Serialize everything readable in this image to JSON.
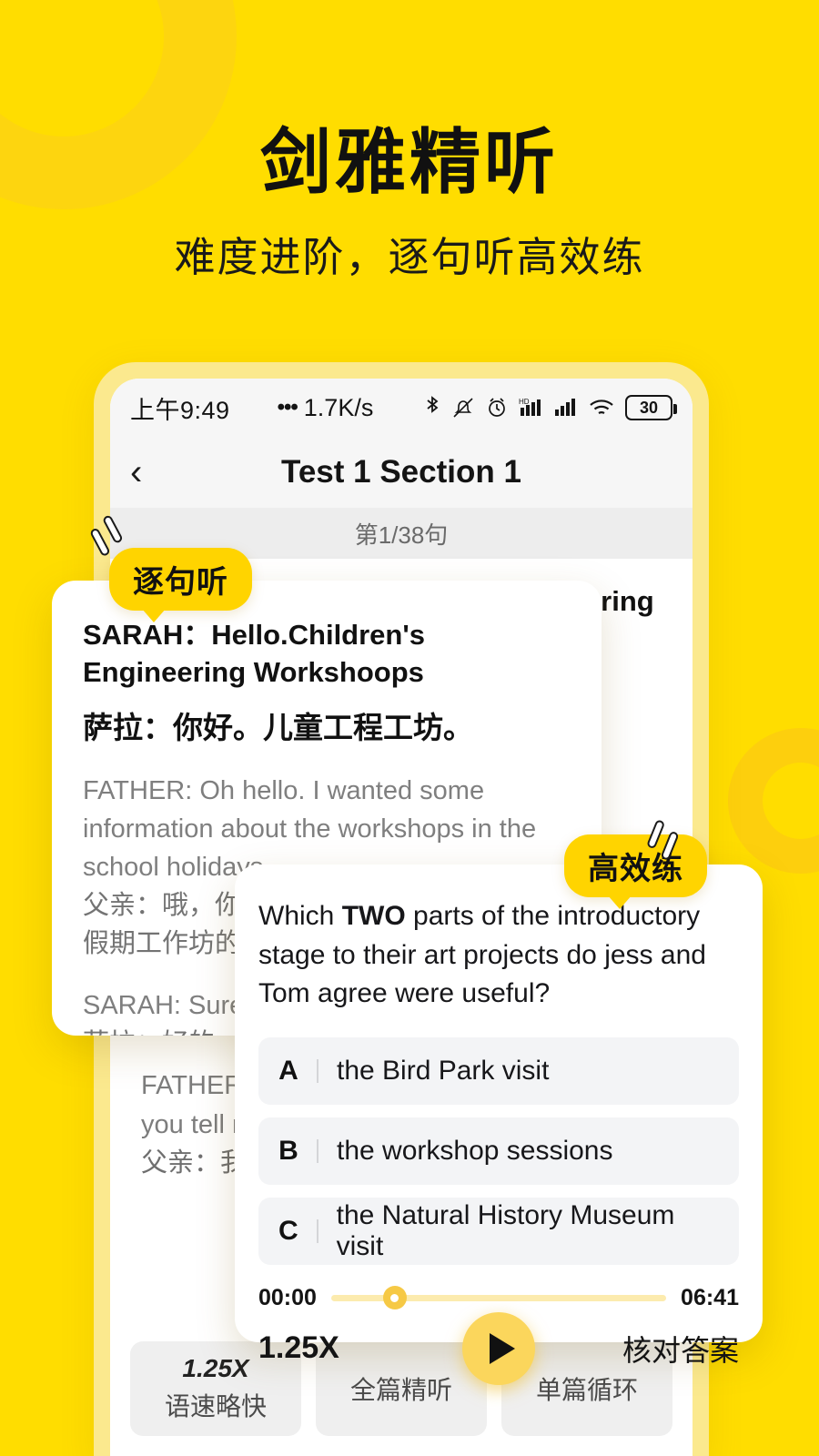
{
  "hero": {
    "title": "剑雅精听",
    "subtitle": "难度进阶，逐句听高效练"
  },
  "colors": {
    "background": "#FFDD00",
    "accent": "#FFD400",
    "phone_bezel": "#FBE98E",
    "play_button": "#FBD65C",
    "option_bg": "#F3F4F6"
  },
  "badges": {
    "listen": "逐句听",
    "practice": "高效练"
  },
  "phone": {
    "statusbar": {
      "time": "上午9:49",
      "dots": "•••",
      "net_speed": "1.7K/s",
      "battery": "30",
      "icons": [
        "bluetooth-icon",
        "bell-mute-icon",
        "alarm-icon",
        "hd-signal-icon",
        "signal-icon",
        "wifi-icon",
        "battery-icon"
      ]
    },
    "navbar": {
      "back": "‹",
      "title": "Test 1 Section 1"
    },
    "subbar": {
      "progress": "第1/38句"
    },
    "transcript": {
      "active_en": "SARAH：Hello.Children's Engineering Workshoops",
      "active_zh": "萨拉：你好。儿童工程工坊。",
      "lines": [
        {
          "en": "FATHER: Oh hello. I wanted some information about the workshops in the school holidays.",
          "zh": "父亲：哦，你好。我想了解一些关于学校假期工作坊的信息。"
        },
        {
          "en": "SARAH: Sure.",
          "zh": "萨拉：好的。"
        },
        {
          "en": "FATHER: I'm interested in the four — could you tell me about that?",
          "zh": "父亲：我的孩子四岁了——你能告诉我吗？"
        }
      ]
    },
    "toolbar": [
      {
        "top": "1.25X",
        "label": "语速略快"
      },
      {
        "top": "",
        "label": "全篇精听"
      },
      {
        "top": "",
        "label": "单篇循环"
      }
    ]
  },
  "transcript_card": {
    "active_en": "SARAH：Hello.Children's Engineering Workshoops",
    "active_zh": "萨拉：你好。儿童工程工坊。",
    "line1_en": "FATHER: Oh hello. I wanted some information about the workshops in the school holidays.",
    "line1_zh": "父亲：哦，你好。我想了解一些关于学校假期工作坊的信息。",
    "line2_en": "SARAH: Sure.",
    "line2_zh": "萨拉：好的。"
  },
  "question_card": {
    "question_pre": "Which ",
    "question_bold": "TWO",
    "question_post": " parts of the introductory stage to their art projects do jess and Tom agree were useful?",
    "options": [
      {
        "letter": "A",
        "label": "the Bird Park visit"
      },
      {
        "letter": "B",
        "label": "the workshop sessions"
      },
      {
        "letter": "C",
        "label": "the Natural  History Museum visit"
      }
    ],
    "player": {
      "current_time": "00:00",
      "total_time": "06:41",
      "progress_percent": "19",
      "speed": "1.25X",
      "check_answer": "核对答案",
      "play_icon": "play-icon"
    }
  }
}
